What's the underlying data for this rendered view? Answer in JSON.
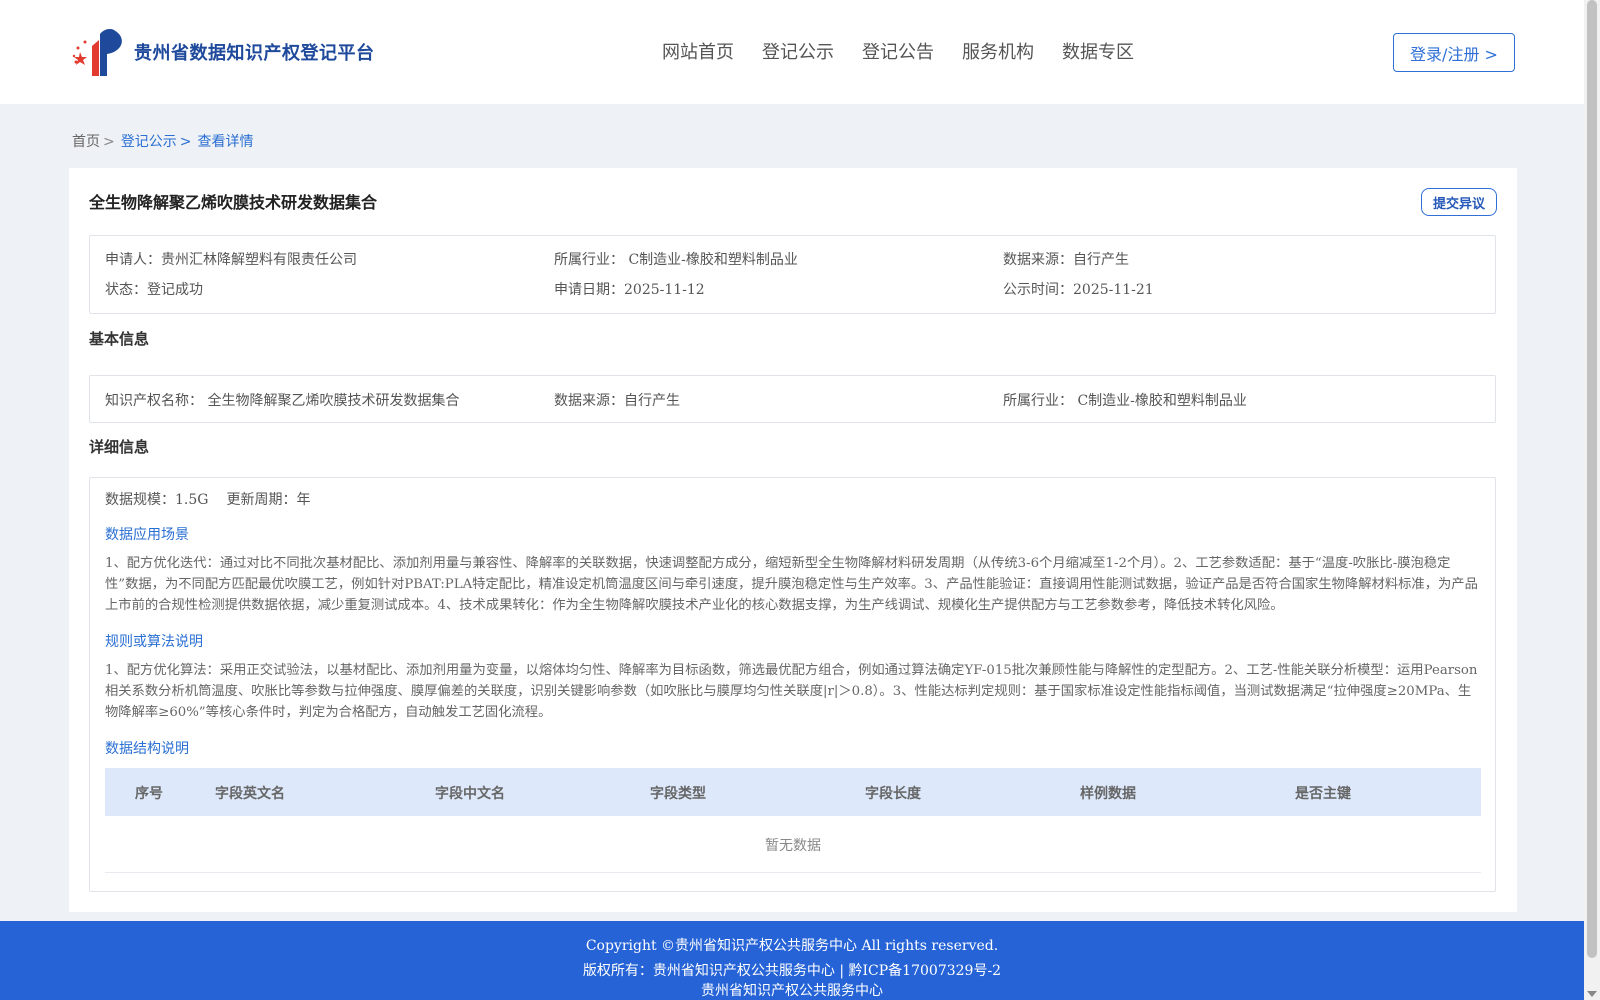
{
  "header": {
    "logo_text": "贵州省数据知识产权登记平台",
    "nav": [
      "网站首页",
      "登记公示",
      "登记公告",
      "服务机构",
      "数据专区"
    ],
    "login_label": "登录/注册 >"
  },
  "breadcrumb": {
    "home": "首页",
    "sep": ">",
    "level1": "登记公示",
    "current": "查看详情"
  },
  "detail": {
    "title": "全生物降解聚乙烯吹膜技术研发数据集合",
    "objection_label": "提交异议",
    "summary": {
      "applicant": "申请人：贵州汇林降解塑料有限责任公司",
      "industry": "所属行业： C制造业-橡胶和塑料制品业",
      "source": "数据来源：自行产生",
      "status": "状态：登记成功",
      "apply_date": "申请日期：2025-11-12",
      "publish_time": "公示时间：2025-11-21"
    },
    "basic_info": {
      "section_title": "基本信息",
      "ip_name": "知识产权名称： 全生物降解聚乙烯吹膜技术研发数据集合",
      "source": "数据来源：自行产生",
      "industry": "所属行业： C制造业-橡胶和塑料制品业"
    },
    "detail_info": {
      "section_title": "详细信息",
      "scale": "数据规模：1.5G",
      "cycle": "更新周期：年",
      "scenario_title": "数据应用场景",
      "scenario_text": "1、配方优化迭代：通过对比不同批次基材配比、添加剂用量与兼容性、降解率的关联数据，快速调整配方成分，缩短新型全生物降解材料研发周期（从传统3-6个月缩减至1-2个月）。2、工艺参数适配：基于“温度-吹胀比-膜泡稳定性”数据，为不同配方匹配最优吹膜工艺，例如针对PBAT:PLA特定配比，精准设定机筒温度区间与牵引速度，提升膜泡稳定性与生产效率。3、产品性能验证：直接调用性能测试数据，验证产品是否符合国家生物降解材料标准，为产品上市前的合规性检测提供数据依据，减少重复测试成本。4、技术成果转化：作为全生物降解吹膜技术产业化的核心数据支撑，为生产线调试、规模化生产提供配方与工艺参数参考，降低技术转化风险。",
      "rules_title": "规则或算法说明",
      "rules_text": "1、配方优化算法：采用正交试验法，以基材配比、添加剂用量为变量，以熔体均匀性、降解率为目标函数，筛选最优配方组合，例如通过算法确定YF-015批次兼顾性能与降解性的定型配方。2、工艺-性能关联分析模型：运用Pearson相关系数分析机筒温度、吹胀比等参数与拉伸强度、膜厚偏差的关联度，识别关键影响参数（如吹胀比与膜厚均匀性关联度|r|＞0.8）。3、性能达标判定规则：基于国家标准设定性能指标阈值，当测试数据满足“拉伸强度≥20MPa、生物降解率≥60%”等核心条件时，判定为合格配方，自动触发工艺固化流程。",
      "structure_title": "数据结构说明",
      "table_headers": [
        "序号",
        "字段英文名",
        "字段中文名",
        "字段类型",
        "字段长度",
        "样例数据",
        "是否主键"
      ],
      "empty_text": "暂无数据"
    }
  },
  "footer": {
    "line1": "Copyright ©贵州省知识产权公共服务中心 All rights reserved.",
    "line2": "版权所有：贵州省知识产权公共服务中心 | 黔ICP备17007329号-2",
    "line3": "贵州省知识产权公共服务中心"
  },
  "colors": {
    "primary": "#2f6fd6",
    "footer_bg": "#2563d6",
    "page_bg": "#eef1f5",
    "table_head_bg": "#dde9fb"
  }
}
